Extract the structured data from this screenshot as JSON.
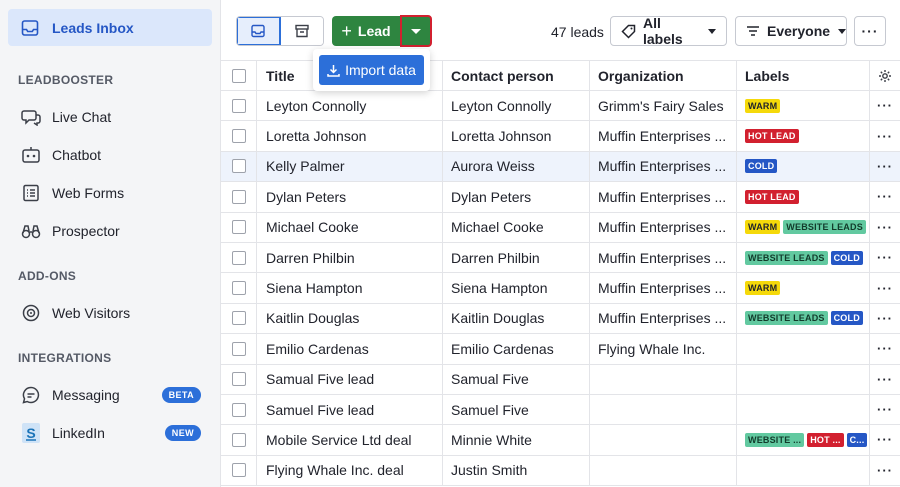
{
  "sidebar": {
    "active": "Leads Inbox",
    "sections": [
      {
        "title": "LEADBOOSTER",
        "items": [
          {
            "label": "Live Chat",
            "icon": "live-chat-icon"
          },
          {
            "label": "Chatbot",
            "icon": "chatbot-icon"
          },
          {
            "label": "Web Forms",
            "icon": "web-forms-icon"
          },
          {
            "label": "Prospector",
            "icon": "binoculars-icon"
          }
        ]
      },
      {
        "title": "ADD-ONS",
        "items": [
          {
            "label": "Web Visitors",
            "icon": "web-visitors-icon"
          }
        ]
      },
      {
        "title": "INTEGRATIONS",
        "items": [
          {
            "label": "Messaging",
            "icon": "messaging-icon",
            "badge": "BETA"
          },
          {
            "label": "LinkedIn",
            "icon": "linkedin-icon",
            "badge": "NEW"
          }
        ]
      }
    ]
  },
  "toolbar": {
    "lead_label": "Lead",
    "import_label": "Import data",
    "count": "47 leads",
    "labels_filter": "All labels",
    "owner_filter": "Everyone",
    "more": "···"
  },
  "colors": {
    "green": "#2e8540",
    "blue": "#2c6fd9",
    "warm": "#f5d90a",
    "hot": "#d2202f",
    "cold": "#2557c5",
    "website": "#62c9a0"
  },
  "table": {
    "headers": {
      "title": "Title",
      "contact": "Contact person",
      "org": "Organization",
      "labels": "Labels"
    },
    "rows": [
      {
        "title": "Leyton Connolly",
        "contact": "Leyton Connolly",
        "org": "Grimm's Fairy Sales",
        "labels": [
          {
            "text": "WARM",
            "kind": "warm"
          }
        ]
      },
      {
        "title": "Loretta Johnson",
        "contact": "Loretta Johnson",
        "org": "Muffin Enterprises ...",
        "labels": [
          {
            "text": "HOT LEAD",
            "kind": "hot"
          }
        ]
      },
      {
        "title": "Kelly Palmer",
        "contact": "Aurora Weiss",
        "org": "Muffin Enterprises ...",
        "labels": [
          {
            "text": "COLD",
            "kind": "cold"
          }
        ],
        "highlight": true
      },
      {
        "title": "Dylan Peters",
        "contact": "Dylan Peters",
        "org": "Muffin Enterprises ...",
        "labels": [
          {
            "text": "HOT LEAD",
            "kind": "hot"
          }
        ]
      },
      {
        "title": "Michael Cooke",
        "contact": "Michael Cooke",
        "org": "Muffin Enterprises ...",
        "labels": [
          {
            "text": "WARM",
            "kind": "warm"
          },
          {
            "text": "WEBSITE LEADS",
            "kind": "website"
          }
        ]
      },
      {
        "title": "Darren Philbin",
        "contact": "Darren Philbin",
        "org": "Muffin Enterprises ...",
        "labels": [
          {
            "text": "WEBSITE LEADS",
            "kind": "website"
          },
          {
            "text": "COLD",
            "kind": "cold"
          }
        ]
      },
      {
        "title": "Siena Hampton",
        "contact": "Siena Hampton",
        "org": "Muffin Enterprises ...",
        "labels": [
          {
            "text": "WARM",
            "kind": "warm"
          }
        ]
      },
      {
        "title": "Kaitlin Douglas",
        "contact": "Kaitlin Douglas",
        "org": "Muffin Enterprises ...",
        "labels": [
          {
            "text": "WEBSITE LEADS",
            "kind": "website"
          },
          {
            "text": "COLD",
            "kind": "cold"
          }
        ]
      },
      {
        "title": "Emilio Cardenas",
        "contact": "Emilio Cardenas",
        "org": "Flying Whale Inc.",
        "labels": []
      },
      {
        "title": "Samual Five lead",
        "contact": "Samual Five",
        "org": "",
        "labels": []
      },
      {
        "title": "Samuel Five lead",
        "contact": "Samuel Five",
        "org": "",
        "labels": []
      },
      {
        "title": "Mobile Service Ltd deal",
        "contact": "Minnie White",
        "org": "",
        "labels": [
          {
            "text": "WEBSITE ...",
            "kind": "website"
          },
          {
            "text": "HOT ...",
            "kind": "hot"
          },
          {
            "text": "C...",
            "kind": "cold"
          }
        ]
      },
      {
        "title": "Flying Whale Inc. deal",
        "contact": "Justin Smith",
        "org": "",
        "labels": []
      }
    ]
  }
}
